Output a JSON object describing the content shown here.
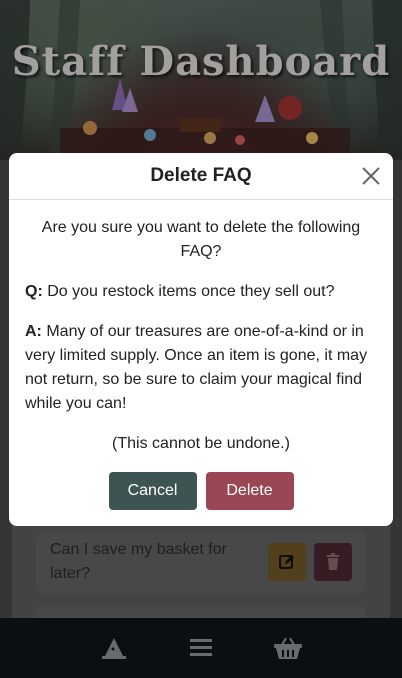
{
  "hero": {
    "title": "Staff Dashboard"
  },
  "faq_list": {
    "items": [
      {
        "question": "Can I save my basket for later?"
      }
    ]
  },
  "modal": {
    "title": "Delete FAQ",
    "prompt": "Are you sure you want to delete the following FAQ?",
    "q_label": "Q:",
    "question": "Do you restock items once they sell out?",
    "a_label": "A:",
    "answer": "Many of our treasures are one-of-a-kind or in very limited supply. Once an item is gone, it may not return, so be sure to claim your magical find while you can!",
    "warning": "(This cannot be undone.)",
    "cancel_label": "Cancel",
    "delete_label": "Delete"
  },
  "bottom_nav": {
    "items": [
      {
        "icon": "wizard-hat-icon"
      },
      {
        "icon": "menu-icon"
      },
      {
        "icon": "basket-icon"
      }
    ]
  },
  "colors": {
    "cancel": "#3e5452",
    "delete": "#9a4654",
    "nav_bg": "#111518"
  }
}
